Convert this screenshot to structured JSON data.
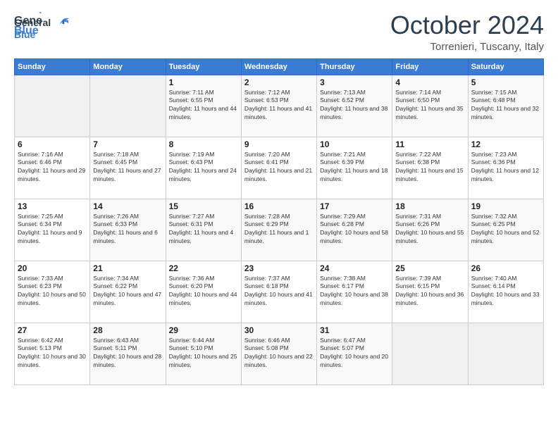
{
  "logo": {
    "general": "General",
    "blue": "Blue"
  },
  "header": {
    "month": "October 2024",
    "location": "Torrenieri, Tuscany, Italy"
  },
  "days_of_week": [
    "Sunday",
    "Monday",
    "Tuesday",
    "Wednesday",
    "Thursday",
    "Friday",
    "Saturday"
  ],
  "weeks": [
    [
      {
        "day": "",
        "content": ""
      },
      {
        "day": "",
        "content": ""
      },
      {
        "day": "1",
        "content": "Sunrise: 7:11 AM\nSunset: 6:55 PM\nDaylight: 11 hours and 44 minutes."
      },
      {
        "day": "2",
        "content": "Sunrise: 7:12 AM\nSunset: 6:53 PM\nDaylight: 11 hours and 41 minutes."
      },
      {
        "day": "3",
        "content": "Sunrise: 7:13 AM\nSunset: 6:52 PM\nDaylight: 11 hours and 38 minutes."
      },
      {
        "day": "4",
        "content": "Sunrise: 7:14 AM\nSunset: 6:50 PM\nDaylight: 11 hours and 35 minutes."
      },
      {
        "day": "5",
        "content": "Sunrise: 7:15 AM\nSunset: 6:48 PM\nDaylight: 11 hours and 32 minutes."
      }
    ],
    [
      {
        "day": "6",
        "content": "Sunrise: 7:16 AM\nSunset: 6:46 PM\nDaylight: 11 hours and 29 minutes."
      },
      {
        "day": "7",
        "content": "Sunrise: 7:18 AM\nSunset: 6:45 PM\nDaylight: 11 hours and 27 minutes."
      },
      {
        "day": "8",
        "content": "Sunrise: 7:19 AM\nSunset: 6:43 PM\nDaylight: 11 hours and 24 minutes."
      },
      {
        "day": "9",
        "content": "Sunrise: 7:20 AM\nSunset: 6:41 PM\nDaylight: 11 hours and 21 minutes."
      },
      {
        "day": "10",
        "content": "Sunrise: 7:21 AM\nSunset: 6:39 PM\nDaylight: 11 hours and 18 minutes."
      },
      {
        "day": "11",
        "content": "Sunrise: 7:22 AM\nSunset: 6:38 PM\nDaylight: 11 hours and 15 minutes."
      },
      {
        "day": "12",
        "content": "Sunrise: 7:23 AM\nSunset: 6:36 PM\nDaylight: 11 hours and 12 minutes."
      }
    ],
    [
      {
        "day": "13",
        "content": "Sunrise: 7:25 AM\nSunset: 6:34 PM\nDaylight: 11 hours and 9 minutes."
      },
      {
        "day": "14",
        "content": "Sunrise: 7:26 AM\nSunset: 6:33 PM\nDaylight: 11 hours and 6 minutes."
      },
      {
        "day": "15",
        "content": "Sunrise: 7:27 AM\nSunset: 6:31 PM\nDaylight: 11 hours and 4 minutes."
      },
      {
        "day": "16",
        "content": "Sunrise: 7:28 AM\nSunset: 6:29 PM\nDaylight: 11 hours and 1 minute."
      },
      {
        "day": "17",
        "content": "Sunrise: 7:29 AM\nSunset: 6:28 PM\nDaylight: 10 hours and 58 minutes."
      },
      {
        "day": "18",
        "content": "Sunrise: 7:31 AM\nSunset: 6:26 PM\nDaylight: 10 hours and 55 minutes."
      },
      {
        "day": "19",
        "content": "Sunrise: 7:32 AM\nSunset: 6:25 PM\nDaylight: 10 hours and 52 minutes."
      }
    ],
    [
      {
        "day": "20",
        "content": "Sunrise: 7:33 AM\nSunset: 6:23 PM\nDaylight: 10 hours and 50 minutes."
      },
      {
        "day": "21",
        "content": "Sunrise: 7:34 AM\nSunset: 6:22 PM\nDaylight: 10 hours and 47 minutes."
      },
      {
        "day": "22",
        "content": "Sunrise: 7:36 AM\nSunset: 6:20 PM\nDaylight: 10 hours and 44 minutes."
      },
      {
        "day": "23",
        "content": "Sunrise: 7:37 AM\nSunset: 6:18 PM\nDaylight: 10 hours and 41 minutes."
      },
      {
        "day": "24",
        "content": "Sunrise: 7:38 AM\nSunset: 6:17 PM\nDaylight: 10 hours and 38 minutes."
      },
      {
        "day": "25",
        "content": "Sunrise: 7:39 AM\nSunset: 6:15 PM\nDaylight: 10 hours and 36 minutes."
      },
      {
        "day": "26",
        "content": "Sunrise: 7:40 AM\nSunset: 6:14 PM\nDaylight: 10 hours and 33 minutes."
      }
    ],
    [
      {
        "day": "27",
        "content": "Sunrise: 6:42 AM\nSunset: 5:13 PM\nDaylight: 10 hours and 30 minutes."
      },
      {
        "day": "28",
        "content": "Sunrise: 6:43 AM\nSunset: 5:11 PM\nDaylight: 10 hours and 28 minutes."
      },
      {
        "day": "29",
        "content": "Sunrise: 6:44 AM\nSunset: 5:10 PM\nDaylight: 10 hours and 25 minutes."
      },
      {
        "day": "30",
        "content": "Sunrise: 6:46 AM\nSunset: 5:08 PM\nDaylight: 10 hours and 22 minutes."
      },
      {
        "day": "31",
        "content": "Sunrise: 6:47 AM\nSunset: 5:07 PM\nDaylight: 10 hours and 20 minutes."
      },
      {
        "day": "",
        "content": ""
      },
      {
        "day": "",
        "content": ""
      }
    ]
  ]
}
